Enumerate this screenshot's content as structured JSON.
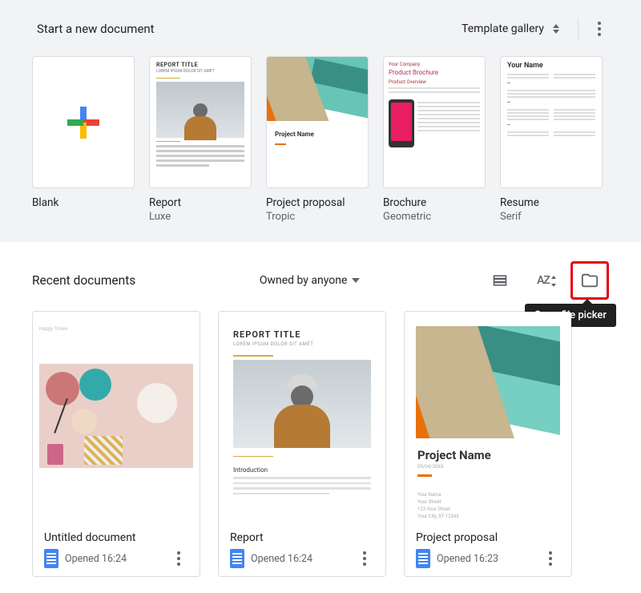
{
  "templates": {
    "header_label": "Start a new document",
    "gallery_label": "Template gallery",
    "items": [
      {
        "title": "Blank",
        "subtitle": ""
      },
      {
        "title": "Report",
        "subtitle": "Luxe"
      },
      {
        "title": "Project proposal",
        "subtitle": "Tropic"
      },
      {
        "title": "Brochure",
        "subtitle": "Geometric"
      },
      {
        "title": "Resume",
        "subtitle": "Serif"
      }
    ]
  },
  "recent": {
    "title": "Recent documents",
    "owner_filter": "Owned by anyone",
    "tooltip": "Open file picker",
    "docs": [
      {
        "title": "Untitled document",
        "meta": "Opened 16:24"
      },
      {
        "title": "Report",
        "meta": "Opened 16:24"
      },
      {
        "title": "Project proposal",
        "meta": "Opened 16:23"
      }
    ]
  },
  "thumb_text": {
    "report_title": "REPORT TITLE",
    "report_sub": "LOREM IPSUM DOLOR SIT AMET",
    "intro": "Introduction",
    "project_name": "Project Name",
    "proj_date": "09/04/20XX",
    "your_name": "Your Name",
    "your_company": "Your Company",
    "product_brochure": "Product Brochure",
    "product_overview": "Product Overview",
    "happy": "Happy Times",
    "foot1": "Your Name",
    "foot2": "Your Street",
    "foot3": "123 Your Street",
    "foot4": "Your City, ST 12345"
  }
}
